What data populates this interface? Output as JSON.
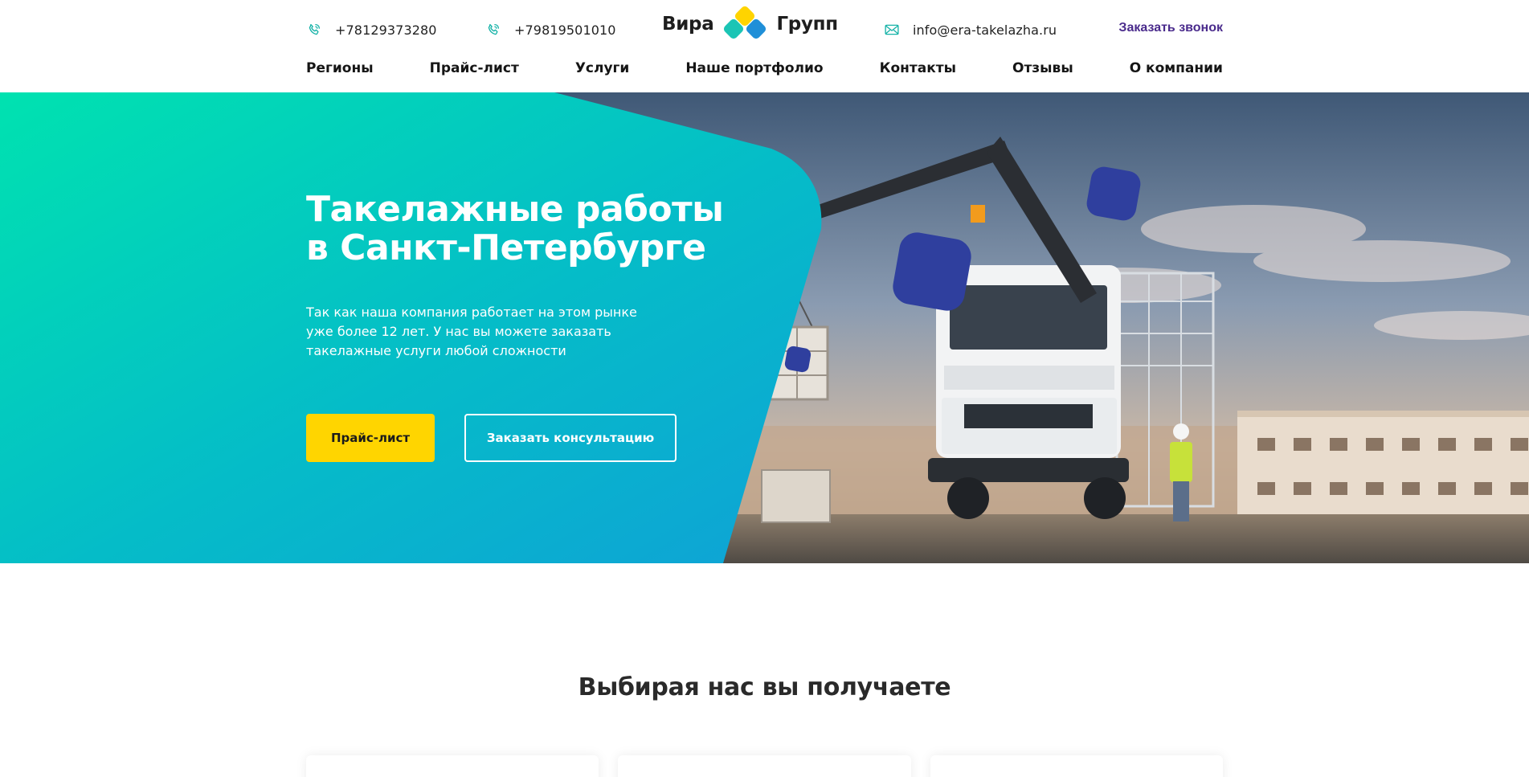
{
  "header": {
    "phones": [
      "+78129373280",
      "+79819501010"
    ],
    "logo": {
      "left_word": "Вира",
      "right_word": "Групп"
    },
    "email": "info@era-takelazha.ru",
    "callback_label": "Заказать звонок",
    "nav": [
      "Регионы",
      "Прайс-лист",
      "Услуги",
      "Наше портфолио",
      "Контакты",
      "Отзывы",
      "О компании"
    ]
  },
  "hero": {
    "title_line1": "Такелажные работы",
    "title_line2": "в Санкт-Петербурге",
    "description_lines": [
      "Так как наша компания работает на этом рынке",
      "уже более 12 лет. У нас вы можете заказать",
      "такелажные услуги любой сложности"
    ],
    "primary_button": "Прайс-лист",
    "secondary_button": "Заказать консультацию"
  },
  "benefits": {
    "title": "Выбирая нас вы получаете"
  },
  "colors": {
    "accent_yellow": "#ffd500",
    "brand_purple": "#4a2b8c",
    "gradient_start": "#00e2b0",
    "gradient_end": "#0fa6d8",
    "deco_square": "#2f3f9e",
    "logo_yellow": "#ffd400",
    "logo_teal": "#1bc5b5",
    "logo_blue": "#1f8fd8"
  },
  "icons": {
    "phone": "phone-icon",
    "email": "envelope-icon"
  }
}
